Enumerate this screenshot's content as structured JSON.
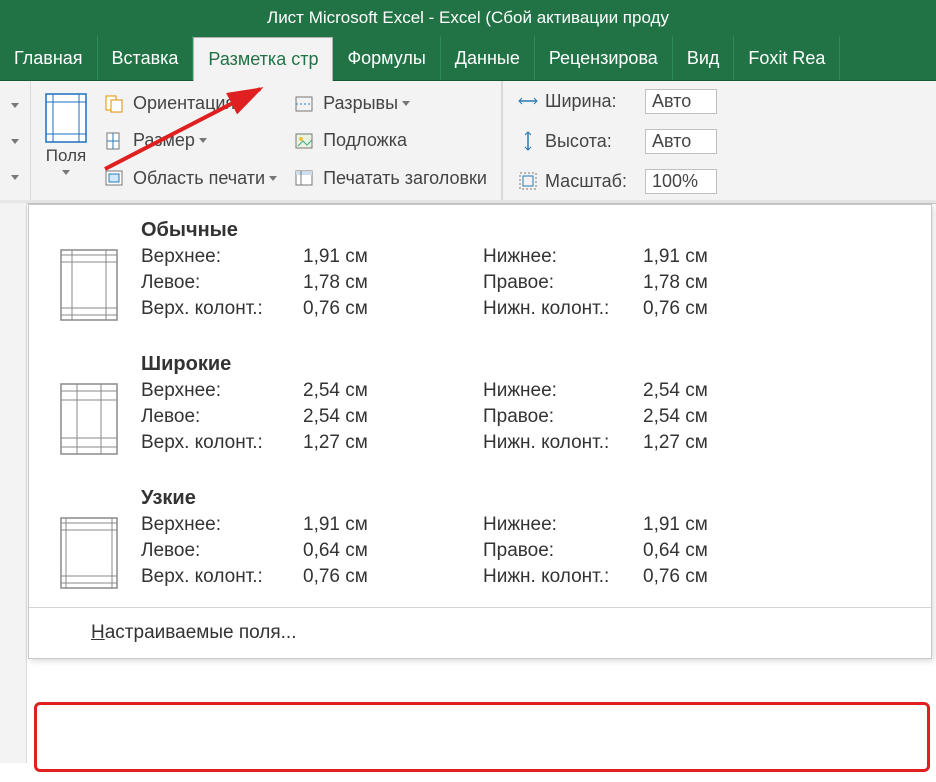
{
  "title": "Лист Microsoft Excel - Excel (Сбой активации проду",
  "tabs": {
    "home": "Главная",
    "insert": "Вставка",
    "page_layout": "Разметка стр",
    "formulas": "Формулы",
    "data": "Данные",
    "review": "Рецензирова",
    "view": "Вид",
    "foxit": "Foxit Rea"
  },
  "ribbon": {
    "margins": "Поля",
    "orientation": "Ориентация",
    "size": "Размер",
    "print_area": "Область печати",
    "breaks": "Разрывы",
    "background": "Подложка",
    "print_titles": "Печатать заголовки",
    "width_label": "Ширина:",
    "width_value": "Авто",
    "height_label": "Высота:",
    "height_value": "Авто",
    "scale_label": "Масштаб:",
    "scale_value": "100%"
  },
  "presets": [
    {
      "name": "Обычные",
      "rows": [
        {
          "l_lbl": "Верхнее:",
          "l_val": "1,91 см",
          "r_lbl": "Нижнее:",
          "r_val": "1,91 см"
        },
        {
          "l_lbl": "Левое:",
          "l_val": "1,78 см",
          "r_lbl": "Правое:",
          "r_val": "1,78 см"
        },
        {
          "l_lbl": "Верх. колонт.:",
          "l_val": "0,76 см",
          "r_lbl": "Нижн. колонт.:",
          "r_val": "0,76 см"
        }
      ]
    },
    {
      "name": "Широкие",
      "rows": [
        {
          "l_lbl": "Верхнее:",
          "l_val": "2,54 см",
          "r_lbl": "Нижнее:",
          "r_val": "2,54 см"
        },
        {
          "l_lbl": "Левое:",
          "l_val": "2,54 см",
          "r_lbl": "Правое:",
          "r_val": "2,54 см"
        },
        {
          "l_lbl": "Верх. колонт.:",
          "l_val": "1,27 см",
          "r_lbl": "Нижн. колонт.:",
          "r_val": "1,27 см"
        }
      ]
    },
    {
      "name": "Узкие",
      "rows": [
        {
          "l_lbl": "Верхнее:",
          "l_val": "1,91 см",
          "r_lbl": "Нижнее:",
          "r_val": "1,91 см"
        },
        {
          "l_lbl": "Левое:",
          "l_val": "0,64 см",
          "r_lbl": "Правое:",
          "r_val": "0,64 см"
        },
        {
          "l_lbl": "Верх. колонт.:",
          "l_val": "0,76 см",
          "r_lbl": "Нижн. колонт.:",
          "r_val": "0,76 см"
        }
      ]
    }
  ],
  "custom_margins_prefix": "Н",
  "custom_margins_rest": "астраиваемые поля..."
}
